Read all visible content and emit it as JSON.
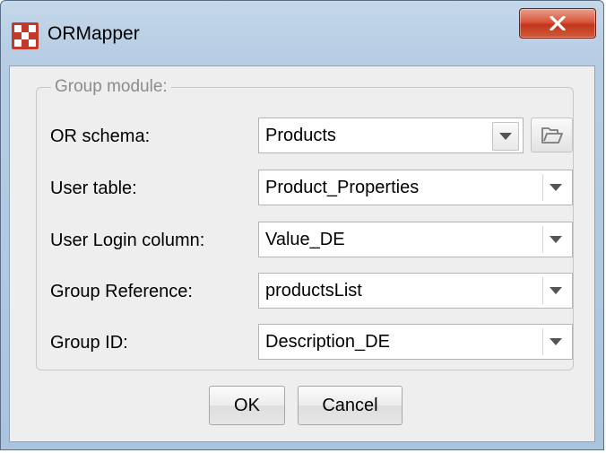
{
  "window": {
    "title": "ORMapper"
  },
  "group": {
    "legend": "Group module:"
  },
  "fields": [
    {
      "label": "OR schema:",
      "value": "Products"
    },
    {
      "label": "User table:",
      "value": "Product_Properties"
    },
    {
      "label": "User Login column:",
      "value": "Value_DE"
    },
    {
      "label": "Group Reference:",
      "value": "productsList"
    },
    {
      "label": "Group ID:",
      "value": "Description_DE"
    }
  ],
  "buttons": {
    "ok_label": "OK",
    "cancel_label": "Cancel"
  },
  "icons": {
    "app": "app-logo-icon",
    "close": "close-icon",
    "browse": "folder-open-icon",
    "dropdown": "chevron-down-icon"
  },
  "colors": {
    "title_bar": "#b7cde3",
    "close_button": "#c83a20",
    "app_icon": "#c0392b",
    "dialog_background": "#eeeeee"
  }
}
